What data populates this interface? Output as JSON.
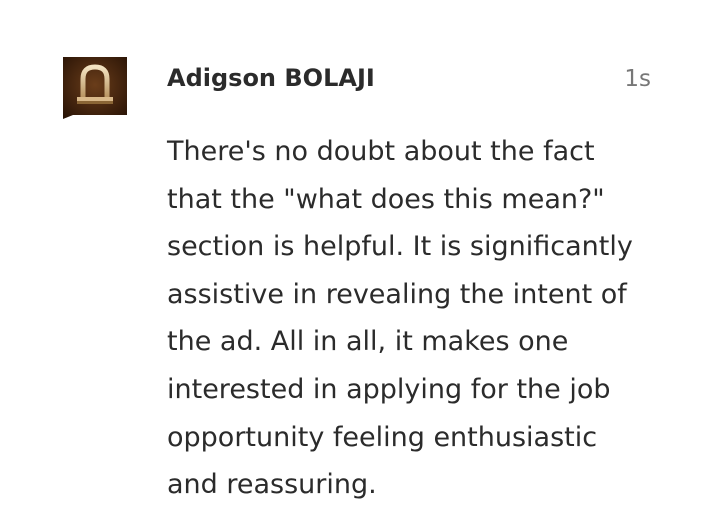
{
  "comment": {
    "author": "Adigson BOLAJI",
    "timestamp": "1s",
    "avatar_icon": "padlock-avatar-icon",
    "body_lines": [
      "There's no doubt about the fact",
      "that the \"what does this mean?\"",
      "section is helpful. It is significantly",
      "assistive in revealing the intent of",
      "the ad. All in all, it makes one",
      "interested in applying for the job",
      "opportunity feeling enthusiastic",
      "and reassuring."
    ]
  },
  "colors": {
    "text": "#2b2b2b",
    "timestamp": "#777777",
    "avatar_bg": "#3a1f0c",
    "avatar_accent": "#e2c79a"
  }
}
